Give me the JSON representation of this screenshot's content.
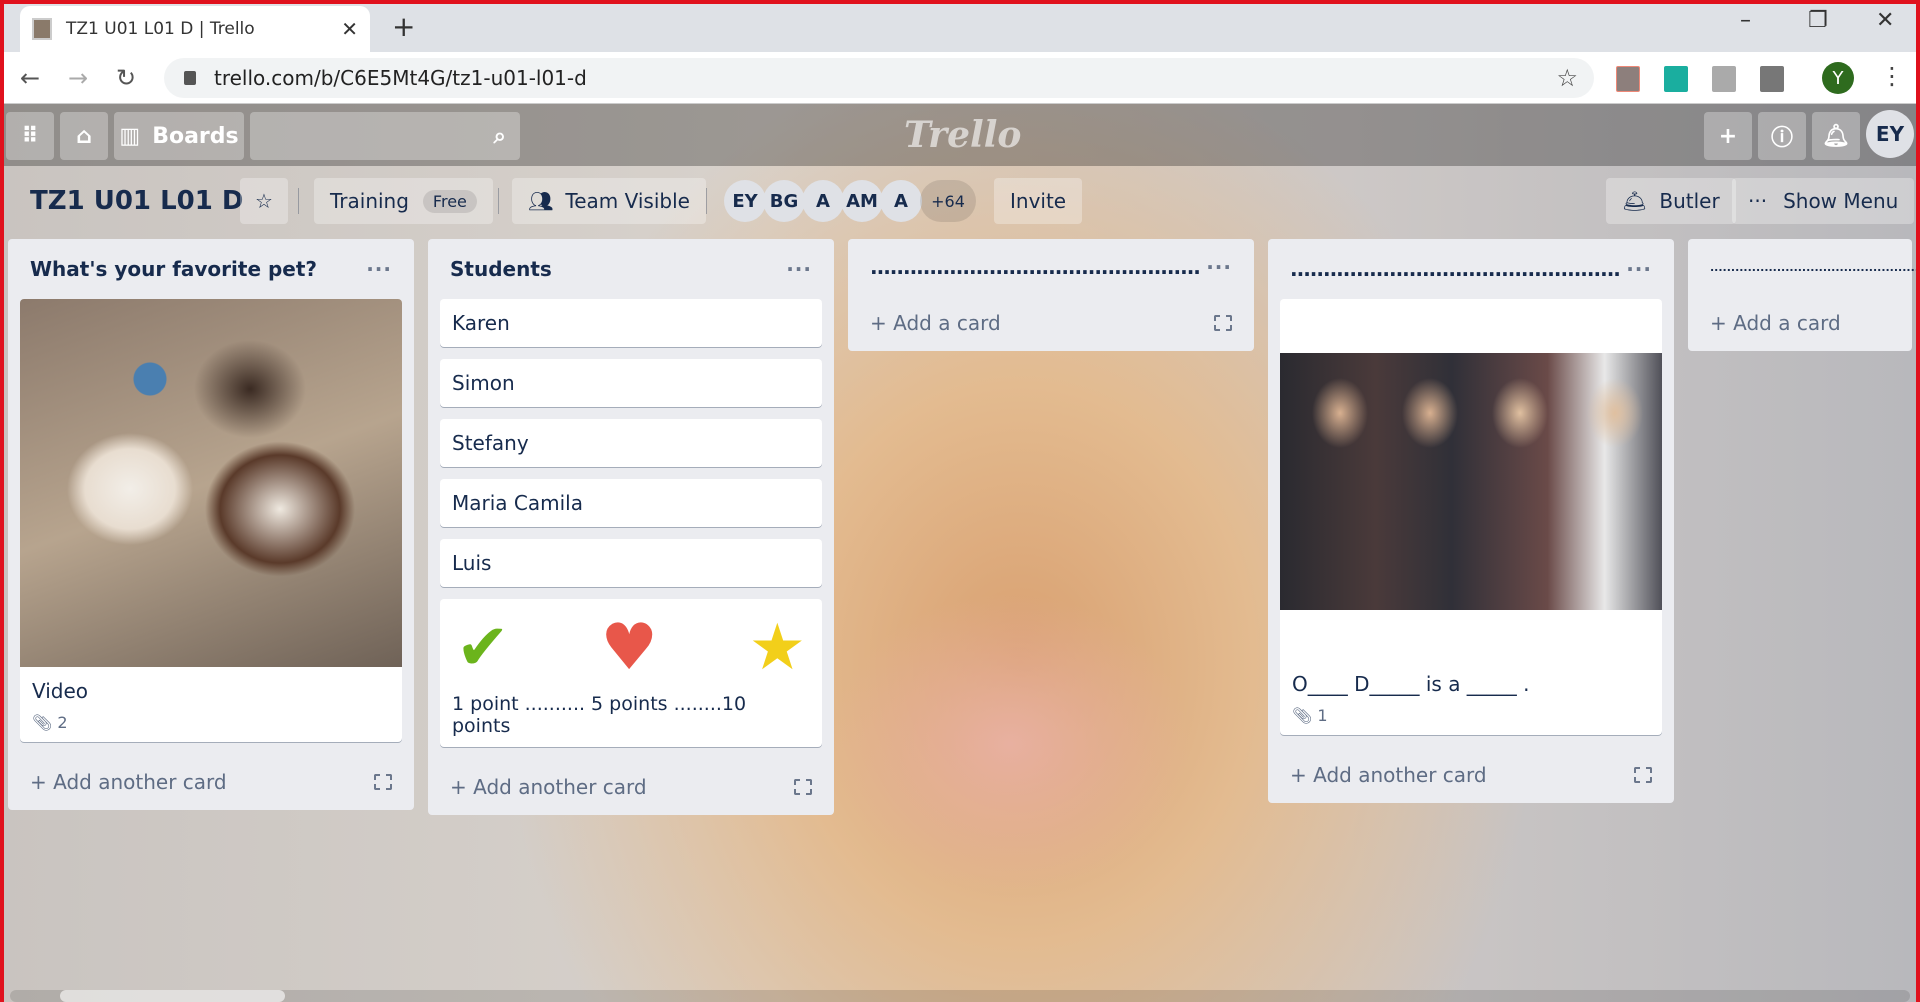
{
  "browser": {
    "tab_title": "TZ1 U01 L01 D | Trello",
    "url": "trello.com/b/C6E5Mt4G/tz1-u01-l01-d",
    "profile_initial": "Y"
  },
  "header": {
    "boards_label": "Boards",
    "logo": "Trello",
    "user_initials": "EY"
  },
  "board": {
    "title": "TZ1 U01 L01 D",
    "team": "Training",
    "team_badge": "Free",
    "visibility": "Team Visible",
    "members": [
      "EY",
      "BG",
      "A",
      "AM",
      "A"
    ],
    "more_members": "+64",
    "invite": "Invite",
    "butler": "Butler",
    "show_menu": "Show Menu"
  },
  "lists": [
    {
      "title": "What's your favorite pet?",
      "cards": [
        {
          "title": "Video",
          "attachments": "2"
        }
      ],
      "add": "Add another card"
    },
    {
      "title": "Students",
      "cards": [
        "Karen",
        "Simon",
        "Stefany",
        "Maria Camila",
        "Luis"
      ],
      "sticker_text": "1 point .......... 5 points ........10 points",
      "add": "Add another card"
    },
    {
      "title": "..................................................",
      "add": "Add a card"
    },
    {
      "title": "..................................................",
      "cards": [
        {
          "title": "O____ D_____ is a _____ .",
          "attachments": "1"
        }
      ],
      "add": "Add another card"
    },
    {
      "title": "..................................................",
      "add": "Add a card"
    }
  ],
  "colors": {
    "accent": "#e0111d",
    "list_bg": "#ebecf0",
    "text": "#172b4d"
  }
}
